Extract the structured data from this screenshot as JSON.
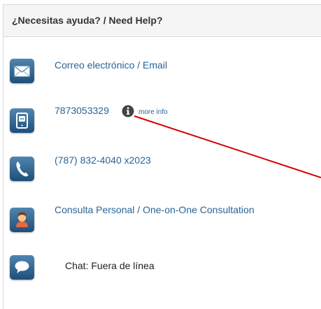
{
  "panel": {
    "title": "¿Necesitas ayuda? / Need Help?"
  },
  "items": [
    {
      "label": "Correo electrónico / Email",
      "icon": "envelope-icon"
    },
    {
      "label": "7873053329",
      "icon": "mobile-chat-icon",
      "info_icon": "info-icon",
      "more_info": "more info"
    },
    {
      "label": "(787) 832-4040 x2023",
      "icon": "phone-icon"
    },
    {
      "label": "Consulta Personal / One-on-One Consultation",
      "icon": "person-icon"
    },
    {
      "label": "Chat: Fuera de línea",
      "icon": "chat-bubble-icon"
    }
  ],
  "colors": {
    "link": "#2a6496",
    "tile": "#2f6690",
    "annotation_arrow": "#d40000",
    "header_bg": "#f5f5f5"
  }
}
